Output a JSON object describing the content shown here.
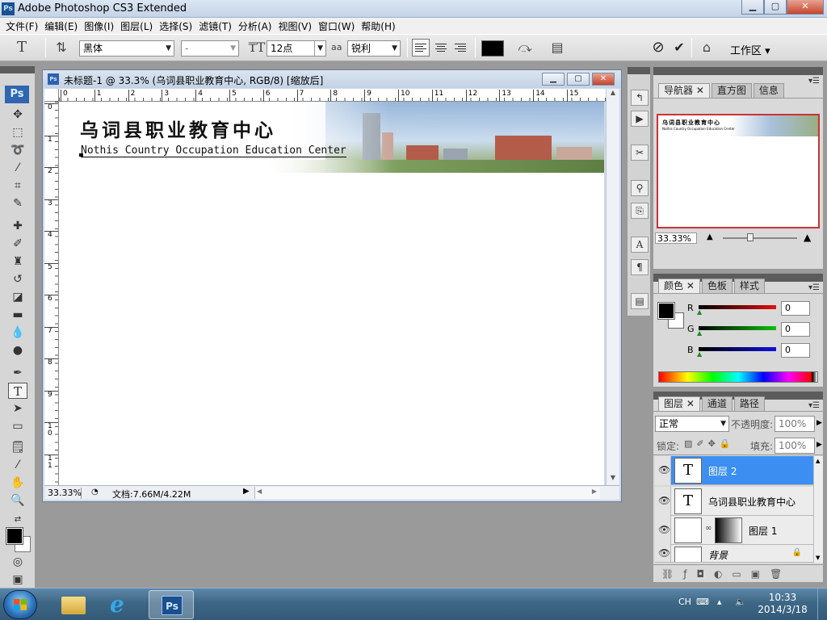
{
  "window": {
    "title": "Adobe Photoshop CS3 Extended",
    "logo": "Ps",
    "minimize": "▁",
    "maximize": "▢",
    "close": "✕"
  },
  "menu": [
    "文件(F)",
    "编辑(E)",
    "图像(I)",
    "图层(L)",
    "选择(S)",
    "滤镜(T)",
    "分析(A)",
    "视图(V)",
    "窗口(W)",
    "帮助(H)"
  ],
  "options": {
    "tool_icon": "T",
    "font_family": "黑体",
    "font_style": "-",
    "font_size": "12点",
    "antialias_label": "aa",
    "antialias": "锐利",
    "cancel": "⊘",
    "commit": "✔",
    "workspace": "工作区 ▾",
    "text_color": "#000000"
  },
  "toolbox": {
    "badge": "Ps"
  },
  "document": {
    "title": "未标题-1 @ 33.3% (乌词县职业教育中心, RGB/8) [缩放后]",
    "ruler_top": [
      "0",
      "1",
      "2",
      "3",
      "4",
      "5",
      "6",
      "7",
      "8",
      "9",
      "10",
      "11",
      "12",
      "13",
      "14",
      "15"
    ],
    "ruler_left": [
      "0",
      "1",
      "2",
      "3",
      "4",
      "5",
      "6",
      "7",
      "8",
      "9",
      "10",
      "11"
    ],
    "zoom": "33.33%",
    "doc_info": "文档:7.66M/4.22M",
    "banner": {
      "title_cn": "乌词县职业教育中心",
      "title_en": "Nothis Country Occupation Education Center"
    }
  },
  "navigator": {
    "tabs": [
      "导航器",
      "直方图",
      "信息"
    ],
    "zoom": "33.33%",
    "mini_cn": "乌词县职业教育中心",
    "mini_en": "Nothis Country Occupation Education Center"
  },
  "color": {
    "tabs": [
      "颜色",
      "色板",
      "样式"
    ],
    "channels": [
      {
        "label": "R",
        "value": "0"
      },
      {
        "label": "G",
        "value": "0"
      },
      {
        "label": "B",
        "value": "0"
      }
    ],
    "fg": "#000000",
    "bg": "#ffffff"
  },
  "layers": {
    "tabs": [
      "图层",
      "通道",
      "路径"
    ],
    "blend_mode": "正常",
    "opacity_label": "不透明度:",
    "opacity": "100%",
    "lock_label": "锁定:",
    "fill_label": "填充:",
    "fill": "100%",
    "items": [
      {
        "name": "图层 2",
        "thumb": "T"
      },
      {
        "name": "乌词县职业教育中心",
        "thumb": "T"
      },
      {
        "name": "图层 1"
      },
      {
        "name": "背景"
      }
    ]
  },
  "taskbar": {
    "ps_label": "Ps",
    "ie_label": "e",
    "lang": "CH",
    "time": "10:33",
    "date": "2014/3/18"
  }
}
